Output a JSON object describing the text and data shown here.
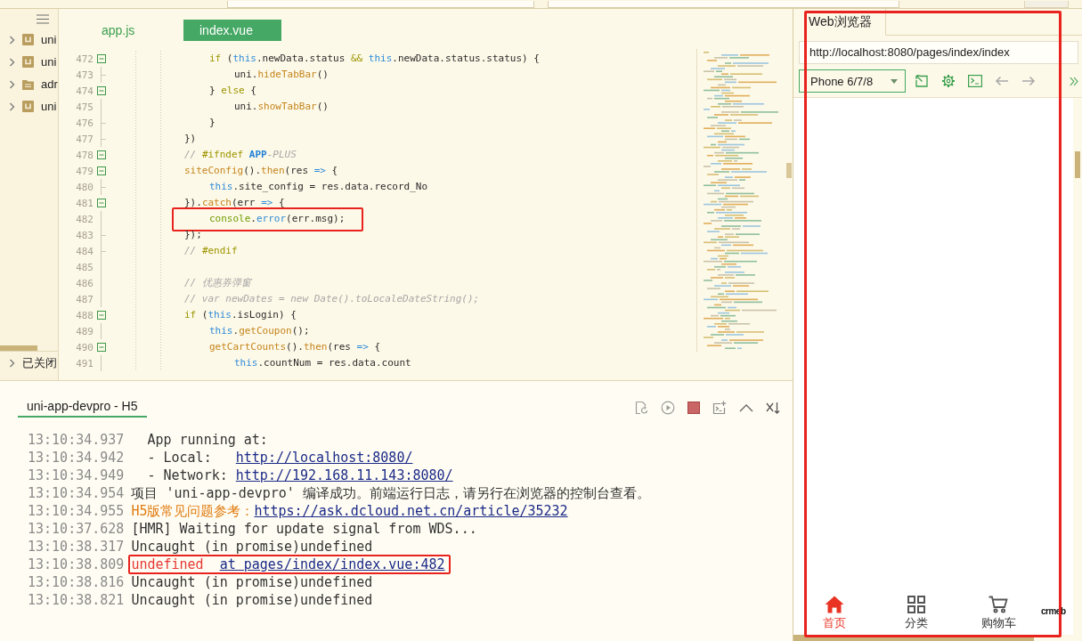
{
  "sidebar": {
    "items": [
      {
        "label": "uni",
        "kind": "project",
        "expanded": false
      },
      {
        "label": "uni",
        "kind": "project",
        "expanded": false
      },
      {
        "label": "adr",
        "kind": "folder",
        "expanded": false
      },
      {
        "label": "uni",
        "kind": "project",
        "expanded": false
      }
    ],
    "closed_projects": {
      "label": "已关闭",
      "expanded": false
    }
  },
  "editor": {
    "tabs": [
      {
        "label": "app.js",
        "selected": false
      },
      {
        "label": "index.vue",
        "selected": true
      }
    ],
    "lines": [
      {
        "number": "472",
        "kind": "collapse",
        "highlighted": false,
        "tokens": [
          {
            "kind": "keyword",
            "text": "\t\t\t\tif"
          },
          {
            "kind": "text",
            "text": " ("
          },
          {
            "kind": "variable",
            "text": "this"
          },
          {
            "kind": "text",
            "text": ".newData.status "
          },
          {
            "kind": "keyword",
            "text": "&&"
          },
          {
            "kind": "variable",
            "text": " this"
          },
          {
            "kind": "text",
            "text": ".newData.status.status) {"
          }
        ]
      },
      {
        "number": "473",
        "kind": "end",
        "highlighted": false,
        "tokens": [
          {
            "kind": "text",
            "text": "\t\t\t\t\tuni."
          },
          {
            "kind": "call",
            "text": "hideTabBar"
          },
          {
            "kind": "text",
            "text": "()"
          }
        ]
      },
      {
        "number": "474",
        "kind": "collapse",
        "highlighted": false,
        "tokens": [
          {
            "kind": "text",
            "text": "\t\t\t\t} "
          },
          {
            "kind": "keyword",
            "text": "else"
          },
          {
            "kind": "text",
            "text": " {"
          }
        ]
      },
      {
        "number": "475",
        "kind": "line",
        "highlighted": false,
        "tokens": [
          {
            "kind": "text",
            "text": "\t\t\t\t\tuni."
          },
          {
            "kind": "call",
            "text": "showTabBar"
          },
          {
            "kind": "text",
            "text": "()"
          }
        ]
      },
      {
        "number": "476",
        "kind": "end",
        "highlighted": false,
        "tokens": [
          {
            "kind": "text",
            "text": "\t\t\t\t}"
          }
        ]
      },
      {
        "number": "477",
        "kind": "end",
        "highlighted": false,
        "tokens": [
          {
            "kind": "text",
            "text": "\t\t\t})"
          }
        ]
      },
      {
        "number": "478",
        "kind": "collapse",
        "highlighted": false,
        "tokens": [
          {
            "kind": "comment",
            "text": "\t\t\t// "
          },
          {
            "kind": "keyword",
            "text": "#ifndef"
          },
          {
            "kind": "constant",
            "text": " APP"
          },
          {
            "kind": "comment",
            "text": "-PLUS"
          }
        ]
      },
      {
        "number": "479",
        "kind": "collapse",
        "highlighted": false,
        "tokens": [
          {
            "kind": "call",
            "text": "\t\t\tsiteConfig"
          },
          {
            "kind": "text",
            "text": "()."
          },
          {
            "kind": "call",
            "text": "then"
          },
          {
            "kind": "text",
            "text": "(res "
          },
          {
            "kind": "variable",
            "text": "=>"
          },
          {
            "kind": "text",
            "text": " {"
          }
        ]
      },
      {
        "number": "480",
        "kind": "end",
        "highlighted": false,
        "tokens": [
          {
            "kind": "variable",
            "text": "\t\t\t\tthis"
          },
          {
            "kind": "text",
            "text": ".site_config = res.data.record_No"
          }
        ]
      },
      {
        "number": "481",
        "kind": "collapse",
        "highlighted": false,
        "tokens": [
          {
            "kind": "text",
            "text": "\t\t\t})."
          },
          {
            "kind": "call",
            "text": "catch"
          },
          {
            "kind": "text",
            "text": "(err "
          },
          {
            "kind": "variable",
            "text": "=>"
          },
          {
            "kind": "text",
            "text": " {"
          }
        ]
      },
      {
        "number": "482",
        "kind": "line",
        "highlighted": true,
        "tokens": [
          {
            "kind": "object",
            "text": "\t\t\t\tconsole"
          },
          {
            "kind": "text",
            "text": "."
          },
          {
            "kind": "variable",
            "text": "error"
          },
          {
            "kind": "text",
            "text": "(err.msg);"
          }
        ]
      },
      {
        "number": "483",
        "kind": "end",
        "highlighted": false,
        "tokens": [
          {
            "kind": "text",
            "text": "\t\t\t});"
          }
        ]
      },
      {
        "number": "484",
        "kind": "end",
        "highlighted": false,
        "tokens": [
          {
            "kind": "comment",
            "text": "\t\t\t// "
          },
          {
            "kind": "keyword",
            "text": "#endif"
          }
        ]
      },
      {
        "number": "485",
        "kind": "line",
        "highlighted": false
      },
      {
        "number": "486",
        "kind": "line",
        "highlighted": false,
        "tokens": [
          {
            "kind": "comment",
            "text": "\t\t\t// 优惠券弹窗"
          }
        ]
      },
      {
        "number": "487",
        "kind": "line",
        "highlighted": false,
        "tokens": [
          {
            "kind": "comment",
            "text": "\t\t\t// var newDates = new Date().toLocaleDateString();"
          }
        ]
      },
      {
        "number": "488",
        "kind": "collapse",
        "highlighted": false,
        "tokens": [
          {
            "kind": "keyword",
            "text": "\t\t\tif"
          },
          {
            "kind": "text",
            "text": " ("
          },
          {
            "kind": "variable",
            "text": "this"
          },
          {
            "kind": "text",
            "text": ".isLogin) {"
          }
        ]
      },
      {
        "number": "489",
        "kind": "line",
        "highlighted": false,
        "tokens": [
          {
            "kind": "variable",
            "text": "\t\t\t\tthis"
          },
          {
            "kind": "text",
            "text": "."
          },
          {
            "kind": "call",
            "text": "getCoupon"
          },
          {
            "kind": "text",
            "text": "();"
          }
        ]
      },
      {
        "number": "490",
        "kind": "collapse",
        "highlighted": false,
        "tokens": [
          {
            "kind": "call",
            "text": "\t\t\t\tgetCartCounts"
          },
          {
            "kind": "text",
            "text": "()."
          },
          {
            "kind": "call",
            "text": "then"
          },
          {
            "kind": "text",
            "text": "(res "
          },
          {
            "kind": "variable",
            "text": "=>"
          },
          {
            "kind": "text",
            "text": " {"
          }
        ]
      },
      {
        "number": "491",
        "kind": "line",
        "highlighted": false,
        "tokens": [
          {
            "kind": "variable",
            "text": "\t\t\t\t\tthis"
          },
          {
            "kind": "text",
            "text": ".countNum = res.data.count"
          }
        ]
      }
    ]
  },
  "console": {
    "tab": {
      "label": "uni-app-devpro - H5",
      "selected": true
    },
    "rows": [
      {
        "time": "13:10:34.937",
        "highlighted": false,
        "parts": [
          {
            "kind": "text",
            "text": "  App running at:"
          }
        ]
      },
      {
        "time": "13:10:34.942",
        "highlighted": false,
        "parts": [
          {
            "kind": "text",
            "text": "  - Local:   "
          },
          {
            "kind": "link",
            "text": "http://localhost:8080/"
          }
        ]
      },
      {
        "time": "13:10:34.949",
        "highlighted": false,
        "parts": [
          {
            "kind": "text",
            "text": "  - Network: "
          },
          {
            "kind": "link",
            "text": "http://192.168.11.143:8080/"
          }
        ]
      },
      {
        "time": "13:10:34.954",
        "highlighted": false,
        "parts": [
          {
            "kind": "text",
            "text": "项目 'uni-app-devpro' 编译成功。前端运行日志，请另行在浏览器的控制台查看。"
          }
        ]
      },
      {
        "time": "13:10:34.955",
        "highlighted": false,
        "parts": [
          {
            "kind": "warning",
            "text": "H5版常见问题参考："
          },
          {
            "kind": "link",
            "text": "https://ask.dcloud.net.cn/article/35232"
          }
        ]
      },
      {
        "time": "13:10:37.628",
        "highlighted": false,
        "parts": [
          {
            "kind": "text",
            "text": "[HMR] Waiting for update signal from WDS..."
          }
        ]
      },
      {
        "time": "13:10:38.317",
        "highlighted": false,
        "parts": [
          {
            "kind": "text",
            "text": "Uncaught (in promise)undefined"
          }
        ]
      },
      {
        "time": "13:10:38.809",
        "highlighted": true,
        "parts": [
          {
            "kind": "error",
            "text": "undefined"
          },
          {
            "kind": "link",
            "text": "at pages/index/index.vue:482"
          }
        ]
      },
      {
        "time": "13:10:38.816",
        "highlighted": false,
        "parts": [
          {
            "kind": "text",
            "text": "Uncaught (in promise)undefined"
          }
        ]
      },
      {
        "time": "13:10:38.821",
        "highlighted": false,
        "parts": [
          {
            "kind": "text",
            "text": "Uncaught (in promise)undefined"
          }
        ]
      }
    ]
  },
  "browser": {
    "highlighted": true,
    "tab": {
      "label": "Web浏览器",
      "selected": true
    },
    "url": "http://localhost:8080/pages/index/index",
    "device": "Phone 6/7/8",
    "tools": [
      {
        "kind": "open",
        "disabled": false
      },
      {
        "kind": "settings",
        "disabled": false
      },
      {
        "kind": "console",
        "disabled": false
      },
      {
        "kind": "back",
        "disabled": true
      },
      {
        "kind": "forward",
        "disabled": true
      },
      {
        "kind": "more",
        "disabled": false
      }
    ],
    "logo": "crmeb",
    "tabbar": [
      {
        "label": "首页",
        "kind": "home",
        "selected": true
      },
      {
        "label": "分类",
        "kind": "category",
        "selected": false
      },
      {
        "label": "购物车",
        "kind": "cart",
        "selected": false
      }
    ]
  }
}
